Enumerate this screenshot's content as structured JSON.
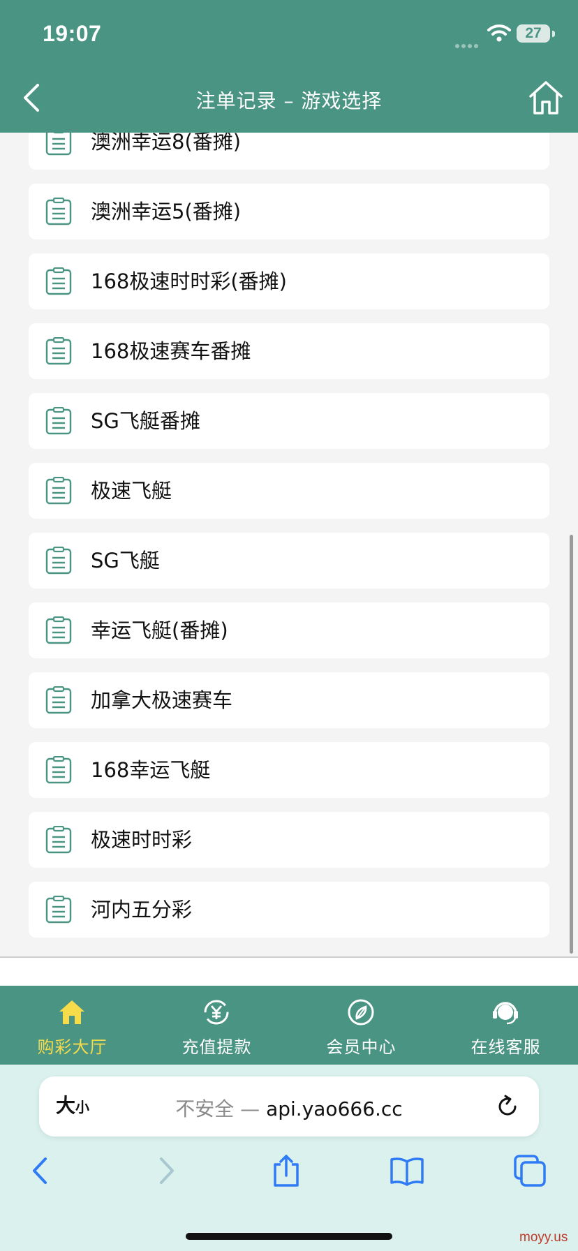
{
  "status_bar": {
    "time": "19:07",
    "battery": "27"
  },
  "header": {
    "title": "注单记录 – 游戏选择",
    "back_icon": "chevron-left-icon",
    "home_icon": "home-icon"
  },
  "games": [
    {
      "label": "澳洲幸运8(番摊)"
    },
    {
      "label": "澳洲幸运5(番摊)"
    },
    {
      "label": "168极速时时彩(番摊)"
    },
    {
      "label": "168极速赛车番摊"
    },
    {
      "label": "SG飞艇番摊"
    },
    {
      "label": "极速飞艇"
    },
    {
      "label": "SG飞艇"
    },
    {
      "label": "幸运飞艇(番摊)"
    },
    {
      "label": "加拿大极速赛车"
    },
    {
      "label": "168幸运飞艇"
    },
    {
      "label": "极速时时彩"
    },
    {
      "label": "河内五分彩"
    }
  ],
  "tabbar": {
    "tabs": [
      {
        "label": "购彩大厅",
        "icon": "home-icon",
        "active": true
      },
      {
        "label": "充值提款",
        "icon": "yuan-exchange-icon",
        "active": false
      },
      {
        "label": "会员中心",
        "icon": "compass-icon",
        "active": false
      },
      {
        "label": "在线客服",
        "icon": "headset-icon",
        "active": false
      }
    ]
  },
  "browser": {
    "text_size_big": "大",
    "text_size_small": "小",
    "insecure_label": "不安全 —",
    "url": "api.yao666.cc"
  },
  "watermark": "moyy.us",
  "colors": {
    "brand_green": "#4a9483",
    "active_tab": "#f6dc4b",
    "browser_bg": "#daf1ed"
  }
}
